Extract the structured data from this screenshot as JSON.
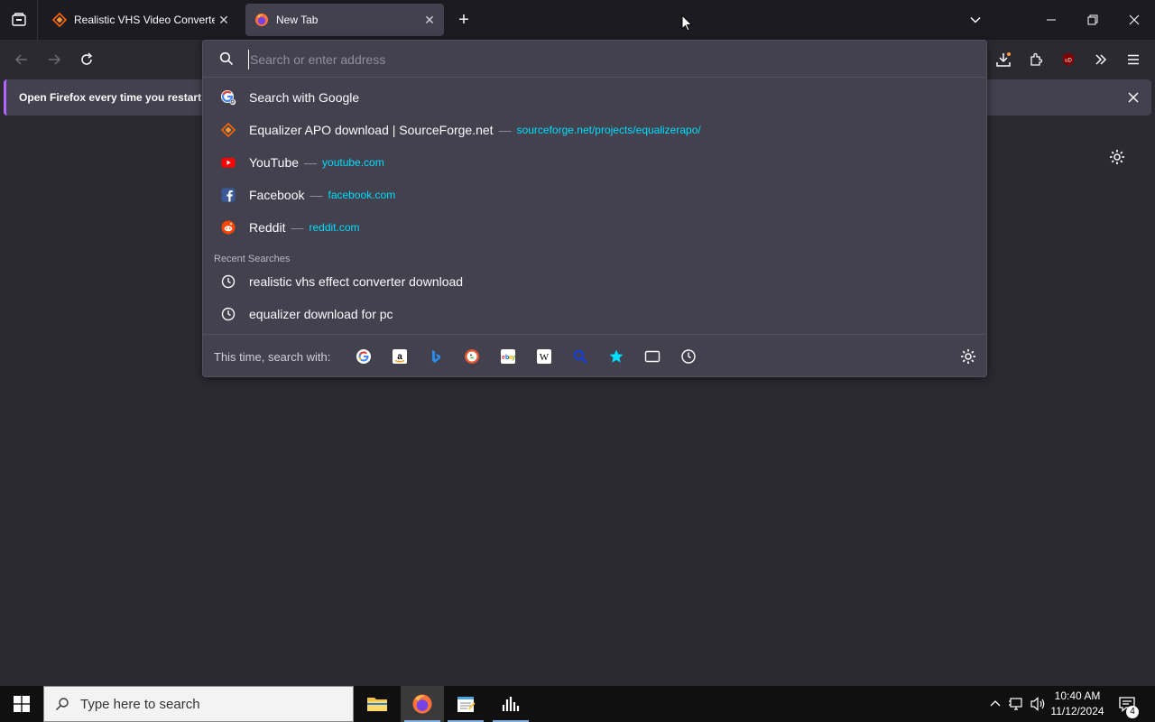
{
  "tabs": [
    {
      "title": "Realistic VHS Video Converter d",
      "icon": "sourceforge-icon",
      "active": false
    },
    {
      "title": "New Tab",
      "icon": "firefox-icon",
      "active": true
    }
  ],
  "notification": {
    "text": "Open Firefox every time you restart y"
  },
  "urlbar": {
    "placeholder": "Search or enter address",
    "results": [
      {
        "title": "Search with Google",
        "url": "",
        "icon": "google-icon"
      },
      {
        "title": "Equalizer APO download | SourceForge.net",
        "url": "sourceforge.net/projects/equalizerapo/",
        "icon": "sourceforge-icon"
      },
      {
        "title": "YouTube",
        "url": "youtube.com",
        "icon": "youtube-icon"
      },
      {
        "title": "Facebook",
        "url": "facebook.com",
        "icon": "facebook-icon"
      },
      {
        "title": "Reddit",
        "url": "reddit.com",
        "icon": "reddit-icon"
      }
    ],
    "recent_label": "Recent Searches",
    "recent": [
      {
        "title": "realistic vhs effect converter download"
      },
      {
        "title": "equalizer download for pc"
      }
    ],
    "oneoff_label": "This time, search with:",
    "engines": [
      "google",
      "amazon",
      "bing",
      "duckduckgo",
      "ebay",
      "wikipedia",
      "search",
      "bookmarks",
      "tabs",
      "history"
    ],
    "separator": "—"
  },
  "taskbar": {
    "search_placeholder": "Type here to search",
    "time": "10:40 AM",
    "date": "11/12/2024",
    "notification_count": "4"
  },
  "colors": {
    "accent_url": "#00ddff",
    "background": "#2b2a33",
    "panel": "#42414d"
  }
}
